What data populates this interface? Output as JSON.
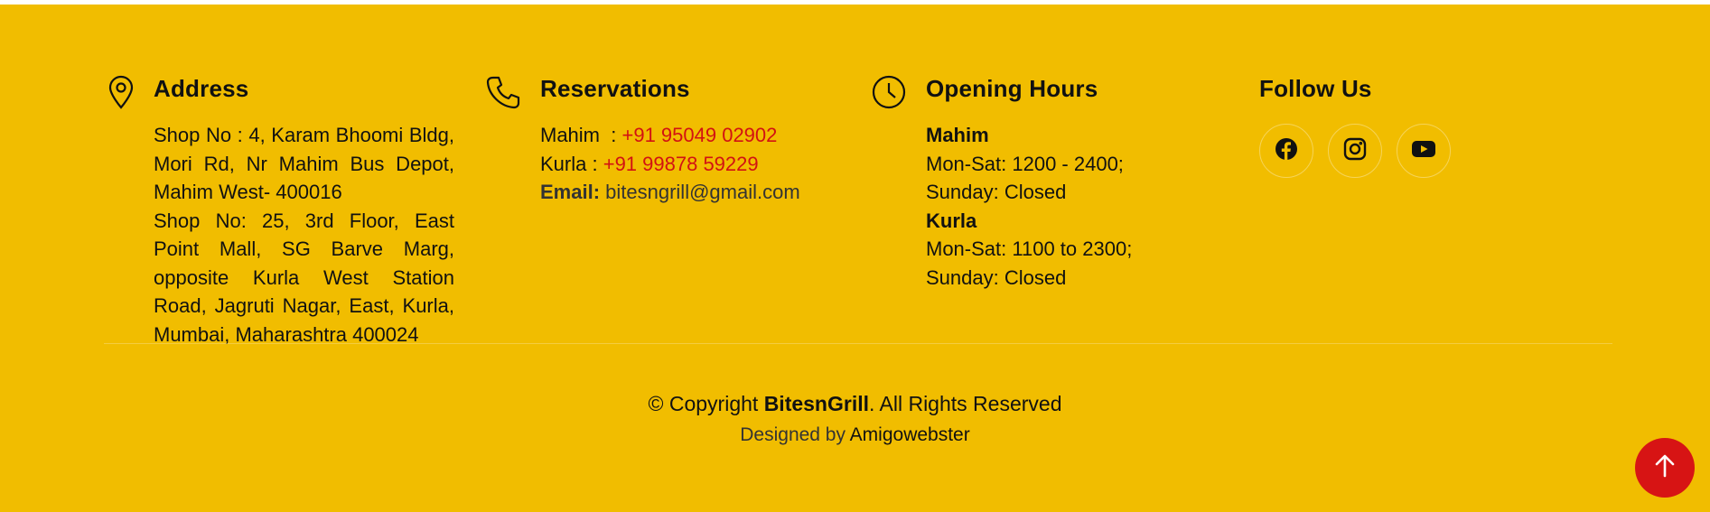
{
  "address": {
    "title": "Address",
    "lines": [
      "Shop No : 4, Karam Bhoomi Bldg, Mori Rd, Nr Mahim Bus Depot, Mahim West- 400016",
      "Shop No: 25, 3rd Floor, East Point Mall, SG Barve Marg, opposite Kurla West Station Road, Jagruti Nagar, East, Kurla, Mumbai, Maharashtra 400024"
    ]
  },
  "reservations": {
    "title": "Reservations",
    "mahim_label": "Mahim  :",
    "mahim_phone": "+91 95049 02902",
    "kurla_label": "Kurla :",
    "kurla_phone": "+91 99878 59229",
    "email_label": "Email:",
    "email_value": "bitesngrill@gmail.com"
  },
  "hours": {
    "title": "Opening Hours",
    "mahim_title": "Mahim",
    "mahim_weekdays": "Mon-Sat: 1200 - 2400;",
    "mahim_sunday": "Sunday: Closed",
    "kurla_title": "Kurla",
    "kurla_weekdays": "Mon-Sat: 1100 to 2300;",
    "kurla_sunday": "Sunday: Closed"
  },
  "follow": {
    "title": "Follow Us",
    "icons": [
      "facebook-icon",
      "instagram-icon",
      "youtube-icon"
    ]
  },
  "footer": {
    "copyright_prefix": "© Copyright ",
    "brand": "BitesnGrill",
    "copyright_suffix": ". All Rights Reserved",
    "designed_by": "Designed by ",
    "designer": "Amigowebster"
  },
  "colors": {
    "background": "#f1bd00",
    "accent": "#d21212",
    "back_to_top": "#d71414"
  }
}
